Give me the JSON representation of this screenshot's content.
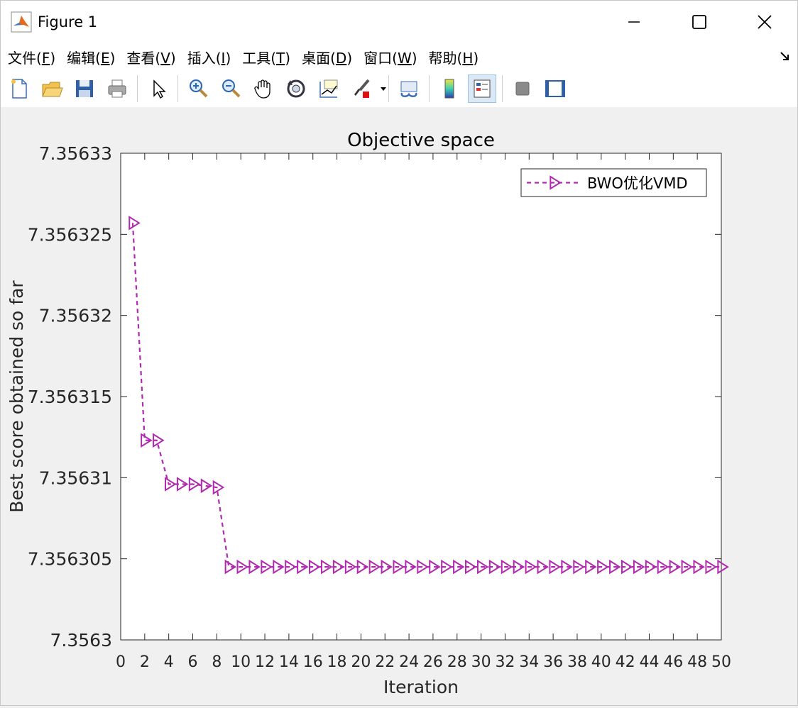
{
  "window": {
    "title": "Figure 1"
  },
  "menu": [
    {
      "label": "文件(",
      "key": "F",
      "end": ")"
    },
    {
      "label": "编辑(",
      "key": "E",
      "end": ")"
    },
    {
      "label": "查看(",
      "key": "V",
      "end": ")"
    },
    {
      "label": "插入(",
      "key": "I",
      "end": ")"
    },
    {
      "label": "工具(",
      "key": "T",
      "end": ")"
    },
    {
      "label": "桌面(",
      "key": "D",
      "end": ")"
    },
    {
      "label": "窗口(",
      "key": "W",
      "end": ")"
    },
    {
      "label": "帮助(",
      "key": "H",
      "end": ")"
    }
  ],
  "toolbar": [
    "new-figure-icon",
    "open-file-icon",
    "save-icon",
    "print-icon",
    "select-pointer-icon",
    "zoom-in-icon",
    "zoom-out-icon",
    "pan-icon",
    "rotate-3d-icon",
    "data-cursor-icon",
    "brush-icon",
    "link-plot-icon",
    "colorbar-icon",
    "legend-icon",
    "hide-plot-tools-icon",
    "show-plot-tools-icon"
  ],
  "chart_data": {
    "type": "line",
    "title": "Objective space",
    "xlabel": "Iteration",
    "ylabel": "Best score obtained so far",
    "xlim": [
      0,
      50
    ],
    "ylim": [
      7.3563,
      7.35633
    ],
    "xticks": [
      0,
      2,
      4,
      6,
      8,
      10,
      12,
      14,
      16,
      18,
      20,
      22,
      24,
      26,
      28,
      30,
      32,
      34,
      36,
      38,
      40,
      42,
      44,
      46,
      48,
      50
    ],
    "yticks": [
      "7.3563",
      "7.356305",
      "7.35631",
      "7.356315",
      "7.35632",
      "7.356325",
      "7.35633"
    ],
    "legend_position": "top-right",
    "series": [
      {
        "name": "BWO优化VMD",
        "color": "#b02ab0",
        "marker": "right-triangle",
        "line": "dashed",
        "x": [
          1,
          2,
          3,
          4,
          5,
          6,
          7,
          8,
          9,
          10,
          11,
          12,
          13,
          14,
          15,
          16,
          17,
          18,
          19,
          20,
          21,
          22,
          23,
          24,
          25,
          26,
          27,
          28,
          29,
          30,
          31,
          32,
          33,
          34,
          35,
          36,
          37,
          38,
          39,
          40,
          41,
          42,
          43,
          44,
          45,
          46,
          47,
          48,
          49,
          50
        ],
        "y": [
          7.3563257,
          7.3563123,
          7.3563123,
          7.3563096,
          7.3563096,
          7.3563096,
          7.3563095,
          7.3563094,
          7.3563045,
          7.3563045,
          7.3563045,
          7.3563045,
          7.3563045,
          7.3563045,
          7.3563045,
          7.3563045,
          7.3563045,
          7.3563045,
          7.3563045,
          7.3563045,
          7.3563045,
          7.3563045,
          7.3563045,
          7.3563045,
          7.3563045,
          7.3563045,
          7.3563045,
          7.3563045,
          7.3563045,
          7.3563045,
          7.3563045,
          7.3563045,
          7.3563045,
          7.3563045,
          7.3563045,
          7.3563045,
          7.3563045,
          7.3563045,
          7.3563045,
          7.3563045,
          7.3563045,
          7.3563045,
          7.3563045,
          7.3563045,
          7.3563045,
          7.3563045,
          7.3563045,
          7.3563045,
          7.3563045,
          7.3563045
        ]
      }
    ]
  }
}
